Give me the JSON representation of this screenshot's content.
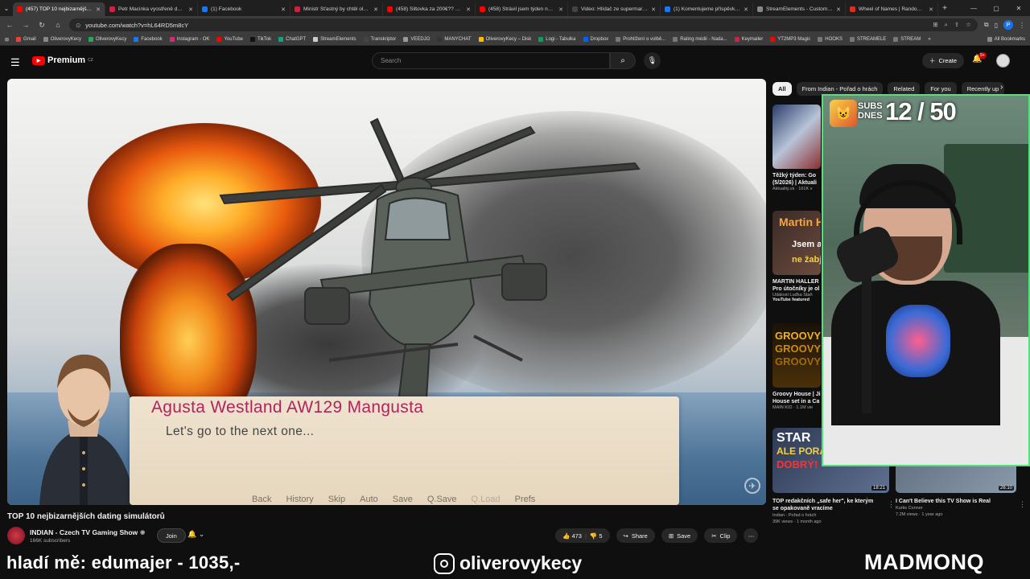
{
  "browser": {
    "tabs": [
      {
        "label": "(457) TOP 10 nejbizarnějších",
        "color": "#ff0000",
        "active": true
      },
      {
        "label": "Petr Macinka vyostřeně debat",
        "color": "#cc2244",
        "active": false
      },
      {
        "label": "(1) Facebook",
        "color": "#1877f2",
        "active": false
      },
      {
        "label": "Ministr Šťastný by chtěl olymp",
        "color": "#cc2244",
        "active": false
      },
      {
        "label": "(458) Šiltovka za 200€?? ● Cl",
        "color": "#ff0000",
        "active": false
      },
      {
        "label": "(458) Strávil jsem týden na Uk",
        "color": "#ff0000",
        "active": false
      },
      {
        "label": "Video: Hlídač ze supermarket",
        "color": "#444444",
        "active": false
      },
      {
        "label": "(1) Komentujeme příspěvky d",
        "color": "#1877f2",
        "active": false
      },
      {
        "label": "StreamElements - Custom co",
        "color": "#888888",
        "active": false
      },
      {
        "label": "Wheel of Names | Random na",
        "color": "#d93025",
        "active": false
      }
    ],
    "url": "youtube.com/watch?v=hL64RD5m8cY",
    "bookmarks": [
      {
        "label": "Gmail",
        "color": "#ea4335"
      },
      {
        "label": "OliverovyKecy",
        "color": "#888888"
      },
      {
        "label": "OliverovyKecy",
        "color": "#22aa55"
      },
      {
        "label": "Facebook",
        "color": "#1877f2"
      },
      {
        "label": "Instagram - OK",
        "color": "#d62976"
      },
      {
        "label": "YouTube",
        "color": "#ff0000"
      },
      {
        "label": "TikTok",
        "color": "#111111"
      },
      {
        "label": "ChatGPT",
        "color": "#10a37f"
      },
      {
        "label": "StreamElements",
        "color": "#cccccc"
      },
      {
        "label": "Transkriptor",
        "color": "#444444"
      },
      {
        "label": "VEEDJO",
        "color": "#999999"
      },
      {
        "label": "MANYCHAT",
        "color": "#333333"
      },
      {
        "label": "OliverovyKecy – Disk",
        "color": "#fbbc04"
      },
      {
        "label": "Logi - Tabulka",
        "color": "#0f9d58"
      },
      {
        "label": "Dropbox",
        "color": "#0061ff"
      },
      {
        "label": "Prohlížení o volbě...",
        "color": "#777777"
      },
      {
        "label": "Rating médií - Nada...",
        "color": "#777777"
      },
      {
        "label": "Keymailer",
        "color": "#cc2244"
      },
      {
        "label": "YT2MP3 Magic",
        "color": "#ff0000"
      },
      {
        "label": "HOOKS",
        "color": "#777777"
      },
      {
        "label": "STREAMELE",
        "color": "#777777"
      },
      {
        "label": "STREAM",
        "color": "#777777"
      }
    ],
    "all_bookmarks": "All Bookmarks"
  },
  "youtube": {
    "logo": "Premium",
    "region": "CZ",
    "search_placeholder": "Search",
    "create_label": "Create",
    "notif_count": "9+"
  },
  "video": {
    "character_name": "Agusta Westland AW129 Mangusta",
    "dialogue": "Let's go to the next one...",
    "vn_menu": [
      "Back",
      "History",
      "Skip",
      "Auto",
      "Save",
      "Q.Save",
      "Q.Load",
      "Prefs"
    ],
    "title": "TOP 10 nejbizarnějších dating simulátorů",
    "channel": "INDIAN - Czech TV Gaming Show",
    "subs": "166K subscribers",
    "join_label": "Join",
    "likes": "473",
    "dislikes": "5",
    "share_label": "Share",
    "save_label": "Save",
    "clip_label": "Clip"
  },
  "sidebar": {
    "chips": [
      "All",
      "From Indian - Pořad o hrách",
      "Related",
      "For you",
      "Recently up"
    ],
    "items": [
      {
        "title": "Těžký týden: Go",
        "title2": "(5/2026) | Aktuali",
        "meta": "Aktuality.sk · 161K v"
      },
      {
        "title": "MARTIN HALLER",
        "title2": "Pro útočníky je ol",
        "meta": "Události Luďka Staň",
        "badge": "YouTube featured",
        "thumb_text": "Martin Hal",
        "thumb_text2": "Jsem ajťák",
        "thumb_text3": "ne žabják"
      },
      {
        "title": "Groovy House | Ji",
        "title2": "House set in a Ca",
        "meta": "MAIN KID · 1.1M vie",
        "thumb_text": "GROOVY"
      }
    ],
    "cards": [
      {
        "title": "TOP redakčních „safe her\", ke kterým",
        "title2": "se opakovaně vracíme",
        "meta": "Indian - Pořad o hrách",
        "meta2": "39K views · 1 month ago",
        "duration": "18:21",
        "thumb_text": "STAR",
        "thumb_text2": "ALE PORÁ",
        "thumb_text3": "DOBRÝ!"
      },
      {
        "title": "I Can't Believe this TV Show is Real",
        "meta": "Kurtis Conner",
        "meta2": "7.2M views · 1 year ago",
        "duration": "26:10"
      }
    ]
  },
  "overlay": {
    "subs_label1": "SUBS",
    "subs_label2": "DNES",
    "subs_count": "12 / 50",
    "donation": "hladí mě: edumajer - 1035,-",
    "instagram": "oliverovykecy",
    "sponsor": "MADMONQ"
  }
}
